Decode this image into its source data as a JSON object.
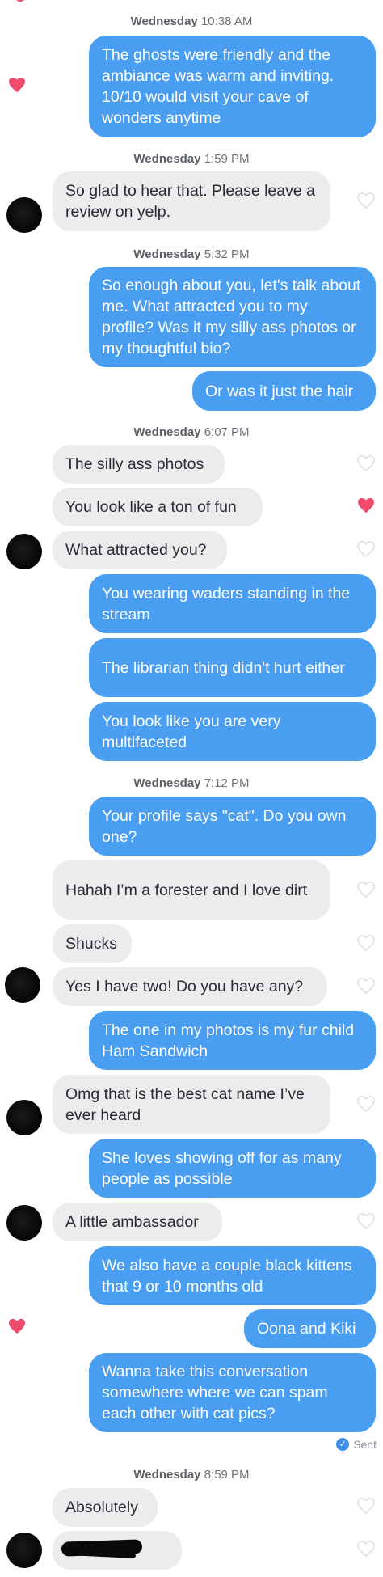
{
  "timestamps": [
    {
      "day": "Wednesday",
      "time": "10:38 AM"
    },
    {
      "day": "Wednesday",
      "time": "1:59 PM"
    },
    {
      "day": "Wednesday",
      "time": "5:32 PM"
    },
    {
      "day": "Wednesday",
      "time": "6:07 PM"
    },
    {
      "day": "Wednesday",
      "time": "7:12 PM"
    },
    {
      "day": "Wednesday",
      "time": "8:59 PM"
    }
  ],
  "messages": [
    {
      "dir": "out",
      "text": "The ghosts were friendly and the ambiance was warm and inviting. 10/10 would visit your cave of wonders anytime",
      "liked": true
    },
    {
      "dir": "in",
      "text": "So glad to hear that. Please leave a review on yelp.",
      "liked": false
    },
    {
      "dir": "out",
      "text": "So enough about you, let's talk about me. What attracted you to my profile? Was it my silly ass photos or my thoughtful bio?",
      "liked": false
    },
    {
      "dir": "out",
      "text": "Or was it just the hair",
      "liked": false
    },
    {
      "dir": "in",
      "text": "The silly ass photos",
      "liked": false
    },
    {
      "dir": "in",
      "text": "You look like a ton of fun",
      "liked": true
    },
    {
      "dir": "in",
      "text": "What attracted you?",
      "liked": false
    },
    {
      "dir": "out",
      "text": "You wearing waders standing in the stream",
      "liked": false
    },
    {
      "dir": "out",
      "text": "The librarian thing didn't hurt either",
      "liked": false
    },
    {
      "dir": "out",
      "text": "You look like you are very multifaceted",
      "liked": false
    },
    {
      "dir": "out",
      "text": "Your profile says \"cat\". Do you own one?",
      "liked": false
    },
    {
      "dir": "in",
      "text": "Hahah I’m a forester and I love dirt",
      "liked": false
    },
    {
      "dir": "in",
      "text": "Shucks",
      "liked": false
    },
    {
      "dir": "in",
      "text": "Yes I have two! Do you have any?",
      "liked": false
    },
    {
      "dir": "out",
      "text": "The one in my photos is my fur child Ham Sandwich",
      "liked": false
    },
    {
      "dir": "in",
      "text": "Omg that is the best cat name I’ve ever heard",
      "liked": false
    },
    {
      "dir": "out",
      "text": "She loves showing off for as many people as possible",
      "liked": false
    },
    {
      "dir": "in",
      "text": "A little ambassador",
      "liked": false
    },
    {
      "dir": "out",
      "text": "We also have a couple black kittens that 9 or 10 months old",
      "liked": false
    },
    {
      "dir": "out",
      "text": "Oona and Kiki",
      "liked": true
    },
    {
      "dir": "out",
      "text": "Wanna take this conversation somewhere where we can spam each other with cat pics?",
      "liked": false
    },
    {
      "dir": "in",
      "text": "Absolutely",
      "liked": false
    }
  ],
  "status": {
    "sent_label": "Sent",
    "sent_icon": "check-icon"
  },
  "colors": {
    "outgoing": "#4a9ef2",
    "incoming": "#ebecee",
    "heart": "#ef4b6c"
  }
}
